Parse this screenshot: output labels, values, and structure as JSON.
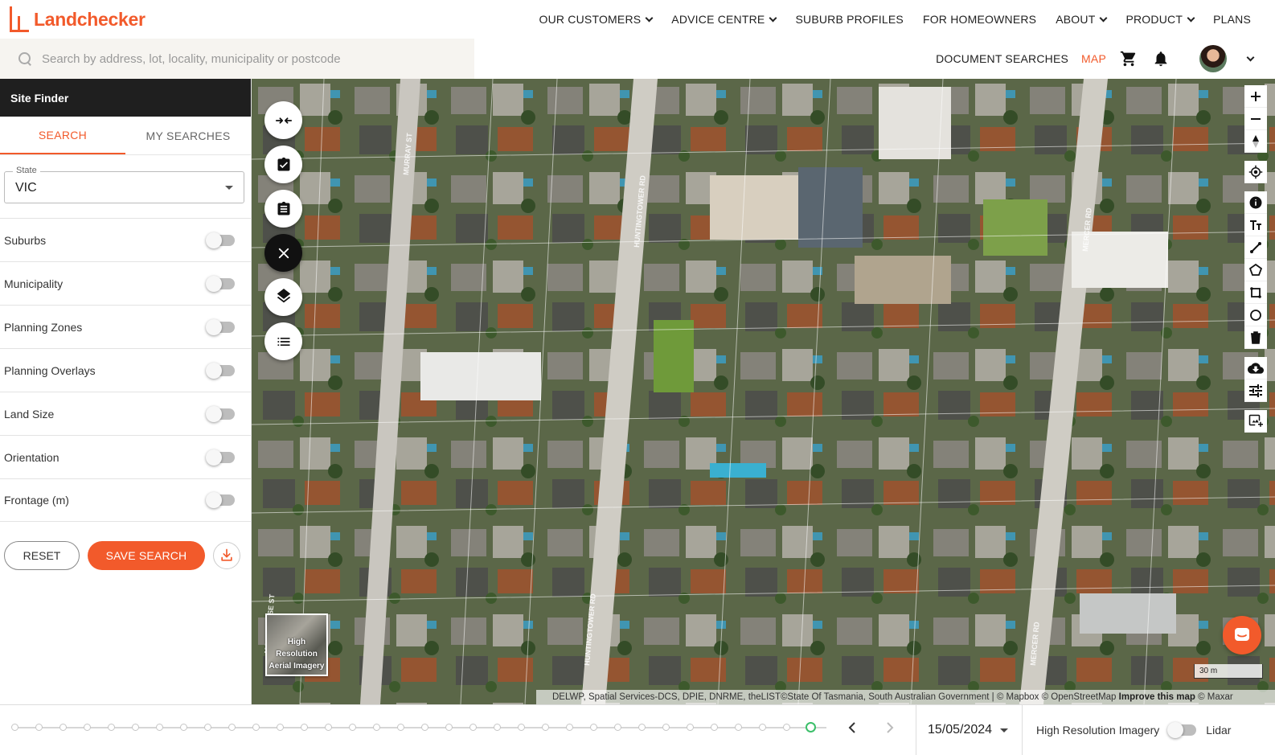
{
  "brand": {
    "name": "Landchecker",
    "color": "#f25a2b"
  },
  "nav": {
    "items": [
      {
        "label": "OUR CUSTOMERS",
        "dropdown": true
      },
      {
        "label": "ADVICE CENTRE",
        "dropdown": true
      },
      {
        "label": "SUBURB PROFILES",
        "dropdown": false
      },
      {
        "label": "FOR HOMEOWNERS",
        "dropdown": false
      },
      {
        "label": "ABOUT",
        "dropdown": true
      },
      {
        "label": "PRODUCT",
        "dropdown": true
      },
      {
        "label": "PLANS",
        "dropdown": false
      }
    ]
  },
  "search": {
    "placeholder": "Search by address, lot, locality, municipality or postcode",
    "value": ""
  },
  "subnav": {
    "document_searches": "DOCUMENT SEARCHES",
    "map": "MAP",
    "cart_icon": "cart-icon",
    "bell_icon": "bell-icon"
  },
  "sidebar": {
    "title": "Site Finder",
    "tabs": [
      {
        "label": "SEARCH",
        "active": true
      },
      {
        "label": "MY SEARCHES",
        "active": false
      }
    ],
    "state": {
      "label": "State",
      "value": "VIC"
    },
    "filters": [
      {
        "label": "Suburbs",
        "on": false
      },
      {
        "label": "Municipality",
        "on": false
      },
      {
        "label": "Planning Zones",
        "on": false
      },
      {
        "label": "Planning Overlays",
        "on": false
      },
      {
        "label": "Land Size",
        "on": false
      },
      {
        "label": "Orientation",
        "on": false
      },
      {
        "label": "Frontage (m)",
        "on": false
      }
    ],
    "reset_label": "RESET",
    "save_label": "SAVE SEARCH"
  },
  "map": {
    "thumb_label_1": "High Resolution",
    "thumb_label_2": "Aerial Imagery",
    "scale": "30 m",
    "attribution": "DELWP, Spatial Services-DCS, DPIE, DNRME, theLIST©State Of Tasmania, South Australian Government | © Mapbox © OpenStreetMap",
    "improve": "Improve this map",
    "maxar": "© Maxar",
    "streets": [
      "MURRAY ST",
      "HUNTINGTOWER RD",
      "MERCER RD",
      "MOORHOUSE ST",
      "HUNTINGTOWER RD",
      "MERCER RD"
    ]
  },
  "timeline": {
    "dot_count": 34,
    "selected_index": 33,
    "date": "15/05/2024",
    "imagery_label": "High Resolution Imagery",
    "lidar_label": "Lidar"
  }
}
